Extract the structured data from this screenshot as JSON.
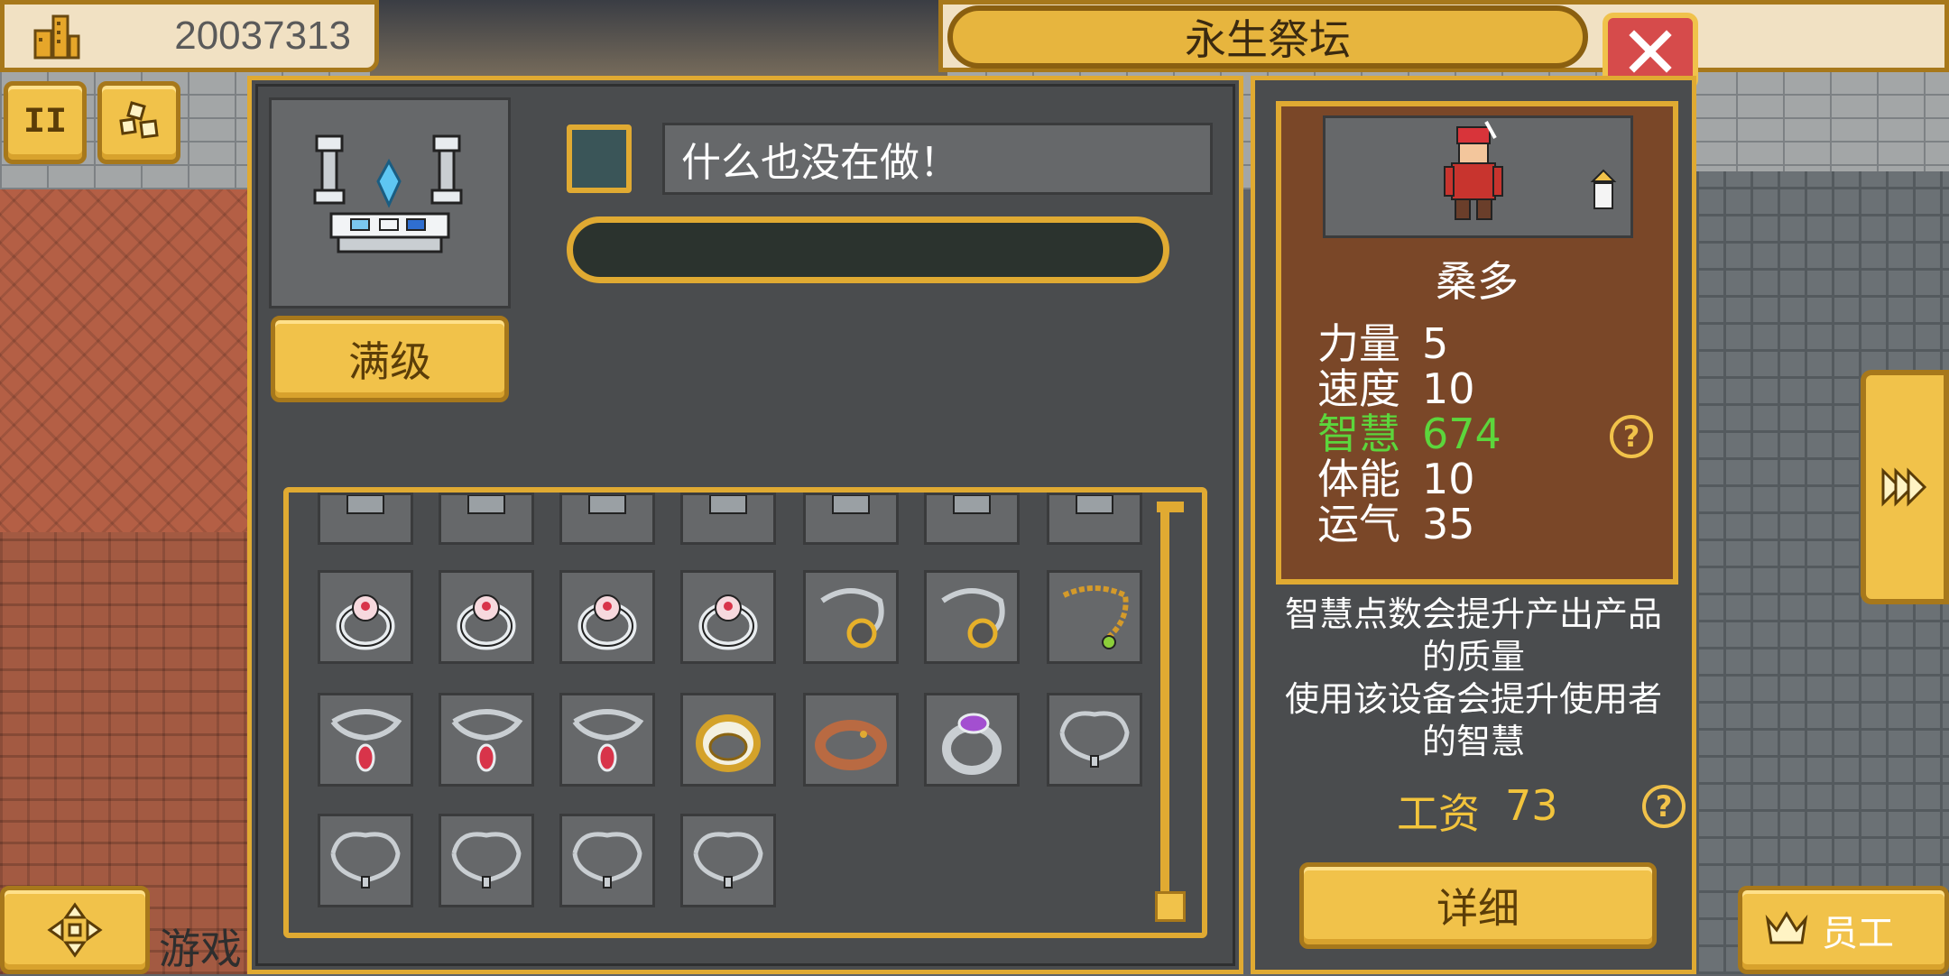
{
  "hud": {
    "money": "20037313",
    "money_icon": "building-icon"
  },
  "window": {
    "title": "永生祭坛",
    "close_icon": "close-icon"
  },
  "machine": {
    "max_level_label": "满级",
    "status_text": "什么也没在做！",
    "progress": 0
  },
  "inventory": {
    "rows": [
      [
        "partial-item",
        "partial-item",
        "partial-item",
        "partial-item",
        "partial-item",
        "partial-item",
        "partial-item"
      ],
      [
        "diamond-ring",
        "diamond-ring",
        "diamond-ring",
        "diamond-ring",
        "silver-necklace-gold",
        "silver-necklace-gold",
        "gold-necklace-green"
      ],
      [
        "ruby-necklace",
        "ruby-necklace",
        "ruby-necklace",
        "gold-ring",
        "leather-bracelet",
        "amethyst-ring",
        "silver-chain"
      ],
      [
        "silver-chain",
        "silver-chain",
        "silver-chain",
        "silver-chain"
      ]
    ]
  },
  "worker": {
    "name": "桑多",
    "stats": [
      {
        "label": "力量",
        "value": "5",
        "highlight": false
      },
      {
        "label": "速度",
        "value": "10",
        "highlight": false
      },
      {
        "label": "智慧",
        "value": "674",
        "highlight": true
      },
      {
        "label": "体能",
        "value": "10",
        "highlight": false
      },
      {
        "label": "运气",
        "value": "35",
        "highlight": false
      }
    ],
    "desc_line1": "智慧点数会提升产出产品",
    "desc_line2": "的质量",
    "desc_line3": "使用该设备会提升使用者",
    "desc_line4": "的智慧",
    "wage_label": "工资",
    "wage_value": "73",
    "detail_label": "详细",
    "help_glyph": "?"
  },
  "side": {
    "pause_glyph": "II",
    "staff_label": "员工",
    "bottom_label": "游戏"
  },
  "colors": {
    "panel_border": "#e0aa32",
    "panel_bg": "#4a4c4e",
    "highlight_stat": "#5cd63c",
    "wage": "#f2c43c",
    "close": "#d64b4b"
  }
}
